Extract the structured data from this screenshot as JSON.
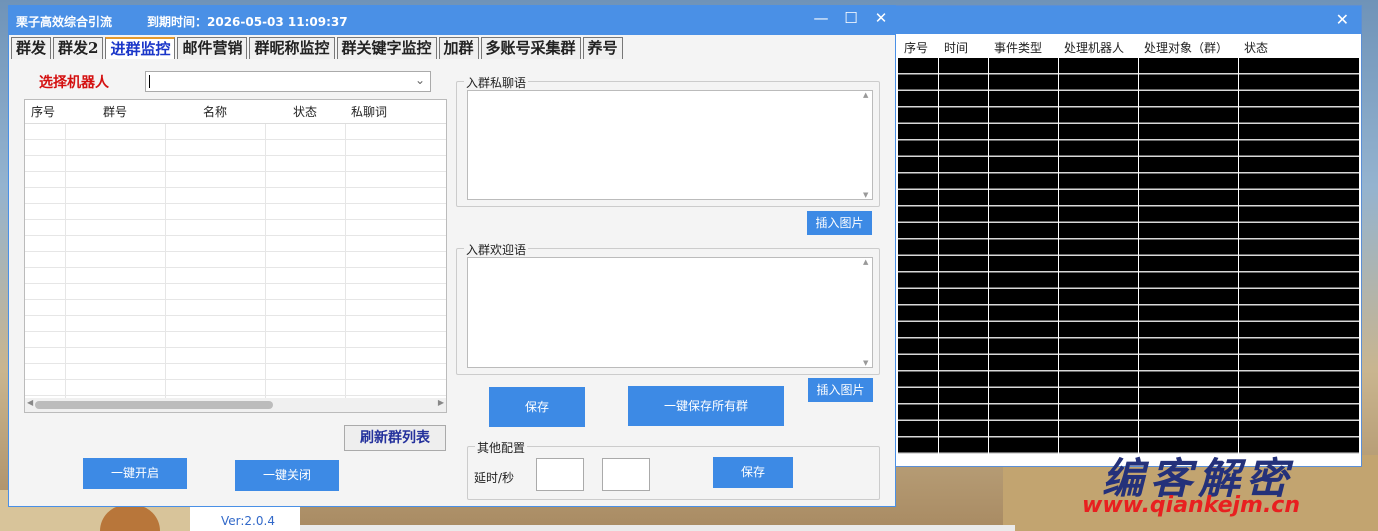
{
  "main_window": {
    "title": "栗子高效综合引流",
    "expiry": "到期时间：2026-05-03 11:09:37",
    "controls": {
      "minimize": "—",
      "maximize": "☐",
      "close": "✕"
    }
  },
  "tabs": [
    {
      "label": "群发"
    },
    {
      "label": "群发2"
    },
    {
      "label": "进群监控",
      "active": true
    },
    {
      "label": "邮件营销"
    },
    {
      "label": "群昵称监控"
    },
    {
      "label": "群关键字监控"
    },
    {
      "label": "加群"
    },
    {
      "label": "多账号采集群"
    },
    {
      "label": "养号"
    }
  ],
  "robot": {
    "label": "选择机器人",
    "value": ""
  },
  "group_table": {
    "headers": [
      "序号",
      "群号",
      "名称",
      "状态",
      "私聊词"
    ],
    "rows": []
  },
  "private_msg": {
    "legend": "入群私聊语",
    "value": "",
    "insert_btn": "插入图片"
  },
  "welcome_msg": {
    "legend": "入群欢迎语",
    "value": "",
    "insert_btn": "插入图片"
  },
  "buttons": {
    "save": "保存",
    "save_all": "一键保存所有群",
    "refresh": "刷新群列表",
    "start": "一键开启",
    "stop": "一键关闭"
  },
  "other_config": {
    "legend": "其他配置",
    "delay_label": "延时/秒",
    "delay_min": "",
    "delay_max": "",
    "save": "保存"
  },
  "version": "Ver:2.0.4",
  "log_window": {
    "close": "✕",
    "headers": [
      "序号",
      "时间",
      "事件类型",
      "处理机器人",
      "处理对象（群）",
      "状态"
    ]
  },
  "watermark": {
    "text": "编客解密",
    "url": "www.qiankejm.cn"
  },
  "colors": {
    "accent": "#4a90e6",
    "button": "#3d8ae5",
    "robot_label": "#d41010",
    "active_tab": "#1a36c9"
  }
}
